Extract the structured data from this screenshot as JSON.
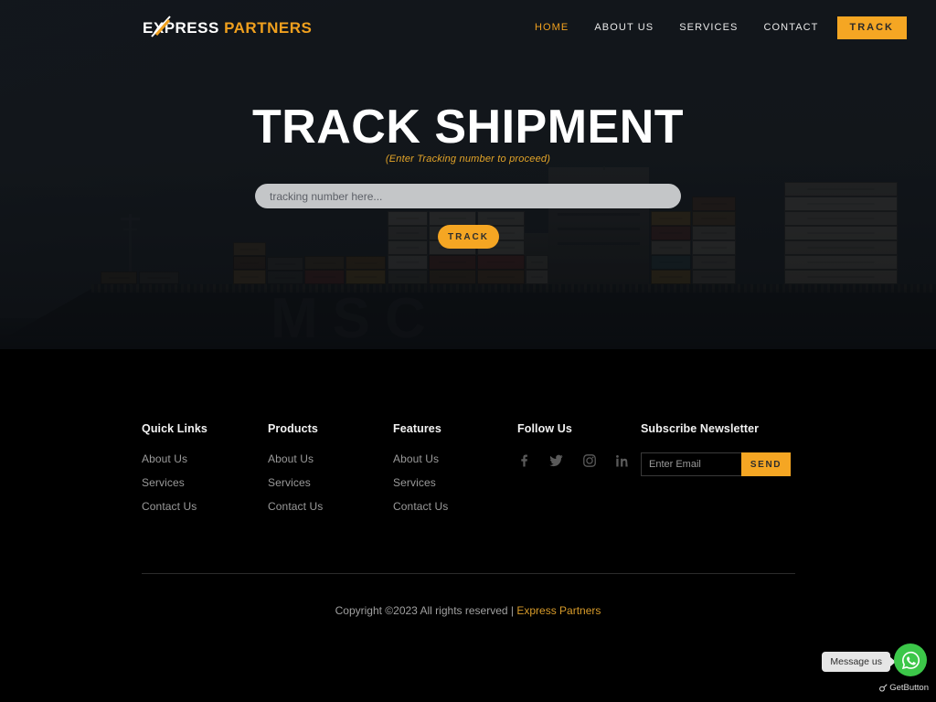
{
  "brand": {
    "name_primary": "EXPRESS",
    "name_secondary": "PARTNERS",
    "accent_color": "#f0a01e"
  },
  "nav": {
    "items": [
      {
        "label": "HOME",
        "active": true
      },
      {
        "label": "ABOUT US",
        "active": false
      },
      {
        "label": "SERVICES",
        "active": false
      },
      {
        "label": "CONTACT",
        "active": false
      }
    ],
    "cta_label": "TRACK"
  },
  "hero": {
    "title": "TRACK SHIPMENT",
    "subtitle": "(Enter Tracking number to proceed)",
    "input_placeholder": "tracking number here...",
    "input_value": "",
    "button_label": "TRACK",
    "background_image": "container-ship-photo",
    "ship_text": "MSC"
  },
  "footer": {
    "columns": [
      {
        "title": "Quick Links",
        "links": [
          "About Us",
          "Services",
          "Contact Us"
        ]
      },
      {
        "title": "Products",
        "links": [
          "About Us",
          "Services",
          "Contact Us"
        ]
      },
      {
        "title": "Features",
        "links": [
          "About Us",
          "Services",
          "Contact Us"
        ]
      }
    ],
    "follow": {
      "title": "Follow Us",
      "socials": [
        "facebook-icon",
        "twitter-icon",
        "instagram-icon",
        "linkedin-icon"
      ]
    },
    "newsletter": {
      "title": "Subscribe Newsletter",
      "placeholder": "Enter Email",
      "value": "",
      "button_label": "SEND"
    },
    "copyright_text": "Copyright ©2023 All rights reserved | ",
    "copyright_brand": "Express Partners"
  },
  "widget": {
    "tooltip": "Message us",
    "provider": "GetButton",
    "icon": "whatsapp-icon",
    "color": "#3cc749"
  },
  "colors": {
    "accent": "#f5a623",
    "hero_bg": "#20262d",
    "footer_bg": "#000000"
  }
}
